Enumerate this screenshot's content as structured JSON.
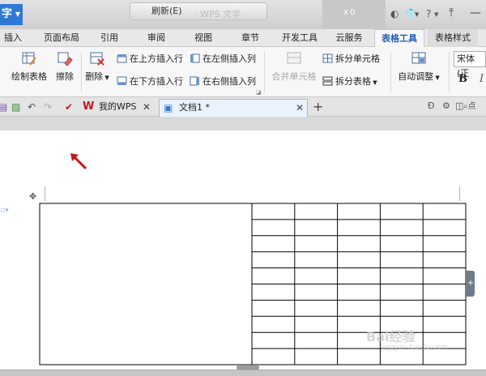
{
  "titlebar": {
    "app_button": "字",
    "refresh_label": "刷新(E)",
    "ghost_title": "· WPS 文字",
    "ghost_close": "x",
    "ghost_num": "0"
  },
  "menu": {
    "tabs": [
      "插入",
      "页面布局",
      "引用",
      "审阅",
      "视图",
      "章节",
      "开发工具",
      "云服务",
      "表格工具",
      "表格样式"
    ],
    "active": "表格工具"
  },
  "ribbon": {
    "draw_table": "绘制表格",
    "erase": "擦除",
    "delete": "删除",
    "insert_above": "在上方插入行",
    "insert_below": "在下方插入行",
    "insert_left": "在左侧插入列",
    "insert_right": "在右侧插入列",
    "merge_cells": "合并单元格",
    "split_cells": "拆分单元格",
    "split_table": "拆分表格",
    "auto_adjust": "自动调整",
    "font_name": "宋体 (正",
    "bold": "B",
    "italic": "I"
  },
  "tabstrip": {
    "home_tab": "我的WPS",
    "doc_tab": "文档1 *",
    "search_hint": "点"
  },
  "watermark": {
    "main": "Bai经验",
    "sub": "jingyan.baidu.com"
  },
  "table": {
    "rows": 10,
    "right_columns": 5,
    "merged_left_cell": true
  },
  "colors": {
    "accent_blue": "#2f78d6",
    "arrow_red": "#c4161c",
    "table_border": "#000000"
  }
}
